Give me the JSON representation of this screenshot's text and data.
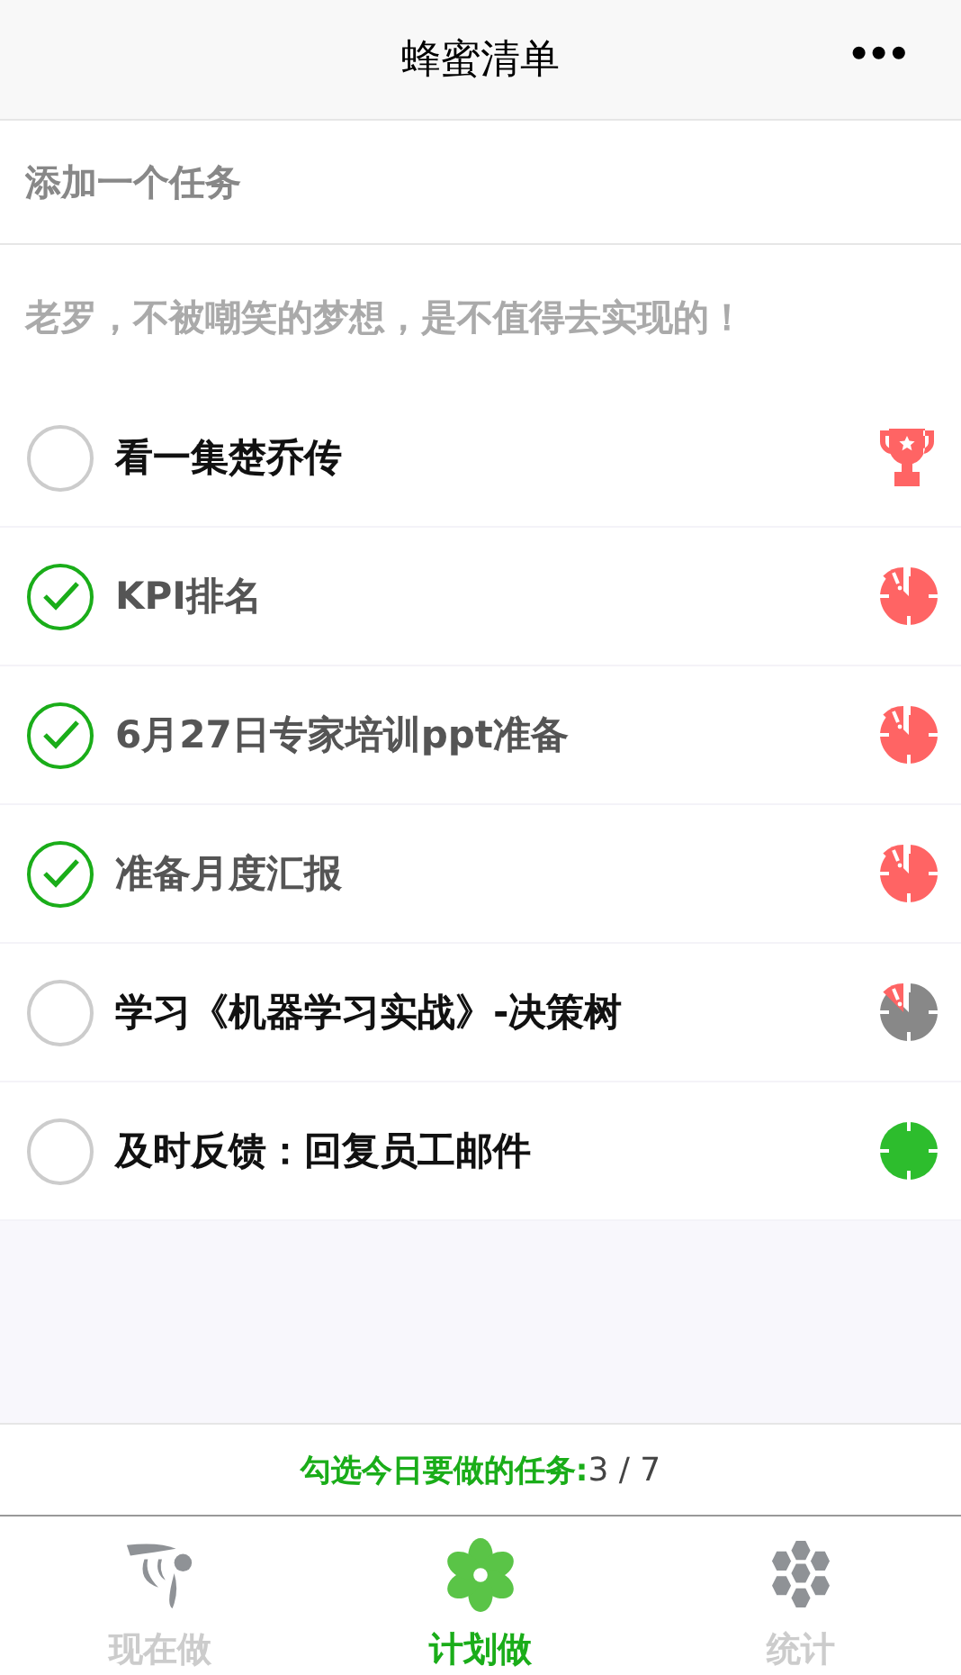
{
  "header": {
    "title": "蜂蜜清单",
    "menu": "•••"
  },
  "add_task": {
    "placeholder": "添加一个任务"
  },
  "motto": "老罗，不被嘲笑的梦想，是不值得去实现的！",
  "tasks": [
    {
      "label": "看一集楚乔传",
      "checked": false,
      "kind": "trophy"
    },
    {
      "label": "KPI排名",
      "checked": true,
      "kind": "clock-red"
    },
    {
      "label": "6月27日专家培训ppt准备",
      "checked": true,
      "kind": "clock-red"
    },
    {
      "label": "准备月度汇报",
      "checked": true,
      "kind": "clock-red"
    },
    {
      "label": "学习《机器学习实战》-决策树",
      "checked": false,
      "kind": "clock-gray"
    },
    {
      "label": "及时反馈：回复员工邮件",
      "checked": false,
      "kind": "clock-green"
    }
  ],
  "summary": {
    "label": "勾选今日要做的任务:",
    "count": "3 / 7"
  },
  "tabs": [
    {
      "label": "现在做",
      "kind": "bee",
      "selected": false
    },
    {
      "label": "计划做",
      "kind": "flower",
      "selected": true
    },
    {
      "label": "统计",
      "kind": "honeycomb",
      "selected": false
    }
  ]
}
